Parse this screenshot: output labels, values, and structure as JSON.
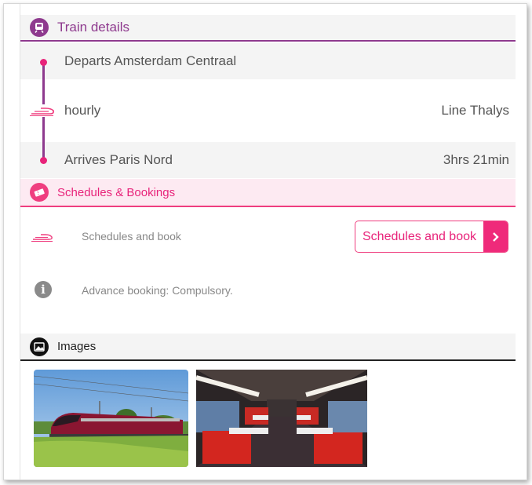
{
  "train_details": {
    "title": "Train details",
    "departs_label": "Departs Amsterdam Centraal",
    "frequency": "hourly",
    "line": "Line Thalys",
    "arrives_label": "Arrives Paris Nord",
    "duration": "3hrs 21min"
  },
  "schedules": {
    "title": "Schedules & Bookings",
    "schedules_label": "Schedules and book",
    "button_label": "Schedules and book",
    "advance_booking": "Advance booking: Compulsory."
  },
  "images": {
    "title": "Images",
    "items": [
      {
        "name": "thalys-train-exterior-photo"
      },
      {
        "name": "thalys-train-interior-photo"
      }
    ]
  },
  "colors": {
    "purple": "#8e3a8e",
    "pink": "#ef3e7f",
    "pink_bg": "#fdeaf2"
  }
}
